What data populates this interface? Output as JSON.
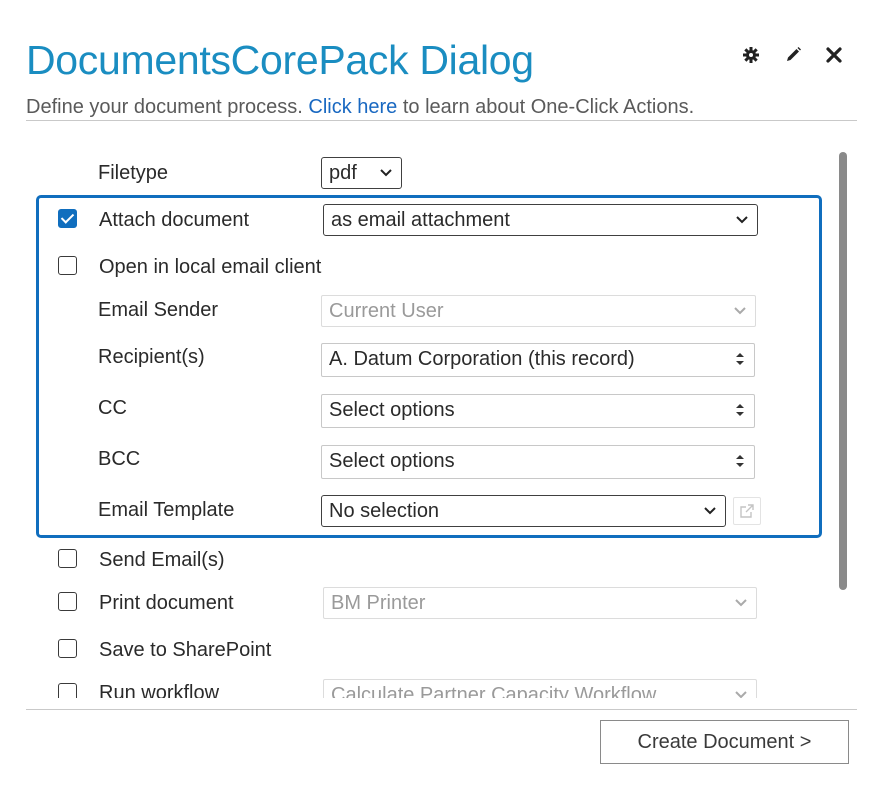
{
  "dialog": {
    "title": "DocumentsCorePack Dialog",
    "subtitle_prefix": "Define your document process.",
    "subtitle_link": "Click here",
    "subtitle_suffix": "to learn about One-Click Actions.",
    "icons": [
      "gear-icon",
      "edit-icon",
      "close-icon"
    ]
  },
  "form": {
    "filetype": {
      "label": "Filetype",
      "value": "pdf"
    },
    "attach_document": {
      "label": "Attach document",
      "checked": true,
      "value": "as email attachment"
    },
    "open_local_email": {
      "label": "Open in local email client",
      "checked": false
    },
    "email_sender": {
      "label": "Email Sender",
      "value": "Current User"
    },
    "recipients": {
      "label": "Recipient(s)",
      "value": "A. Datum Corporation (this record)"
    },
    "cc": {
      "label": "CC",
      "value": "Select options"
    },
    "bcc": {
      "label": "BCC",
      "value": "Select options"
    },
    "email_template": {
      "label": "Email Template",
      "value": "No selection"
    },
    "send_email": {
      "label": "Send Email(s)",
      "checked": false
    },
    "print_document": {
      "label": "Print document",
      "checked": false,
      "value": "BM Printer"
    },
    "save_sharepoint": {
      "label": "Save to SharePoint",
      "checked": false
    },
    "run_workflow": {
      "label": "Run workflow",
      "checked": false,
      "value": "Calculate Partner Capacity Workflow"
    }
  },
  "footer": {
    "create_label": "Create Document >"
  },
  "colors": {
    "title": "#1a8dc1",
    "accent": "#106ebe",
    "link": "#1968c1"
  }
}
